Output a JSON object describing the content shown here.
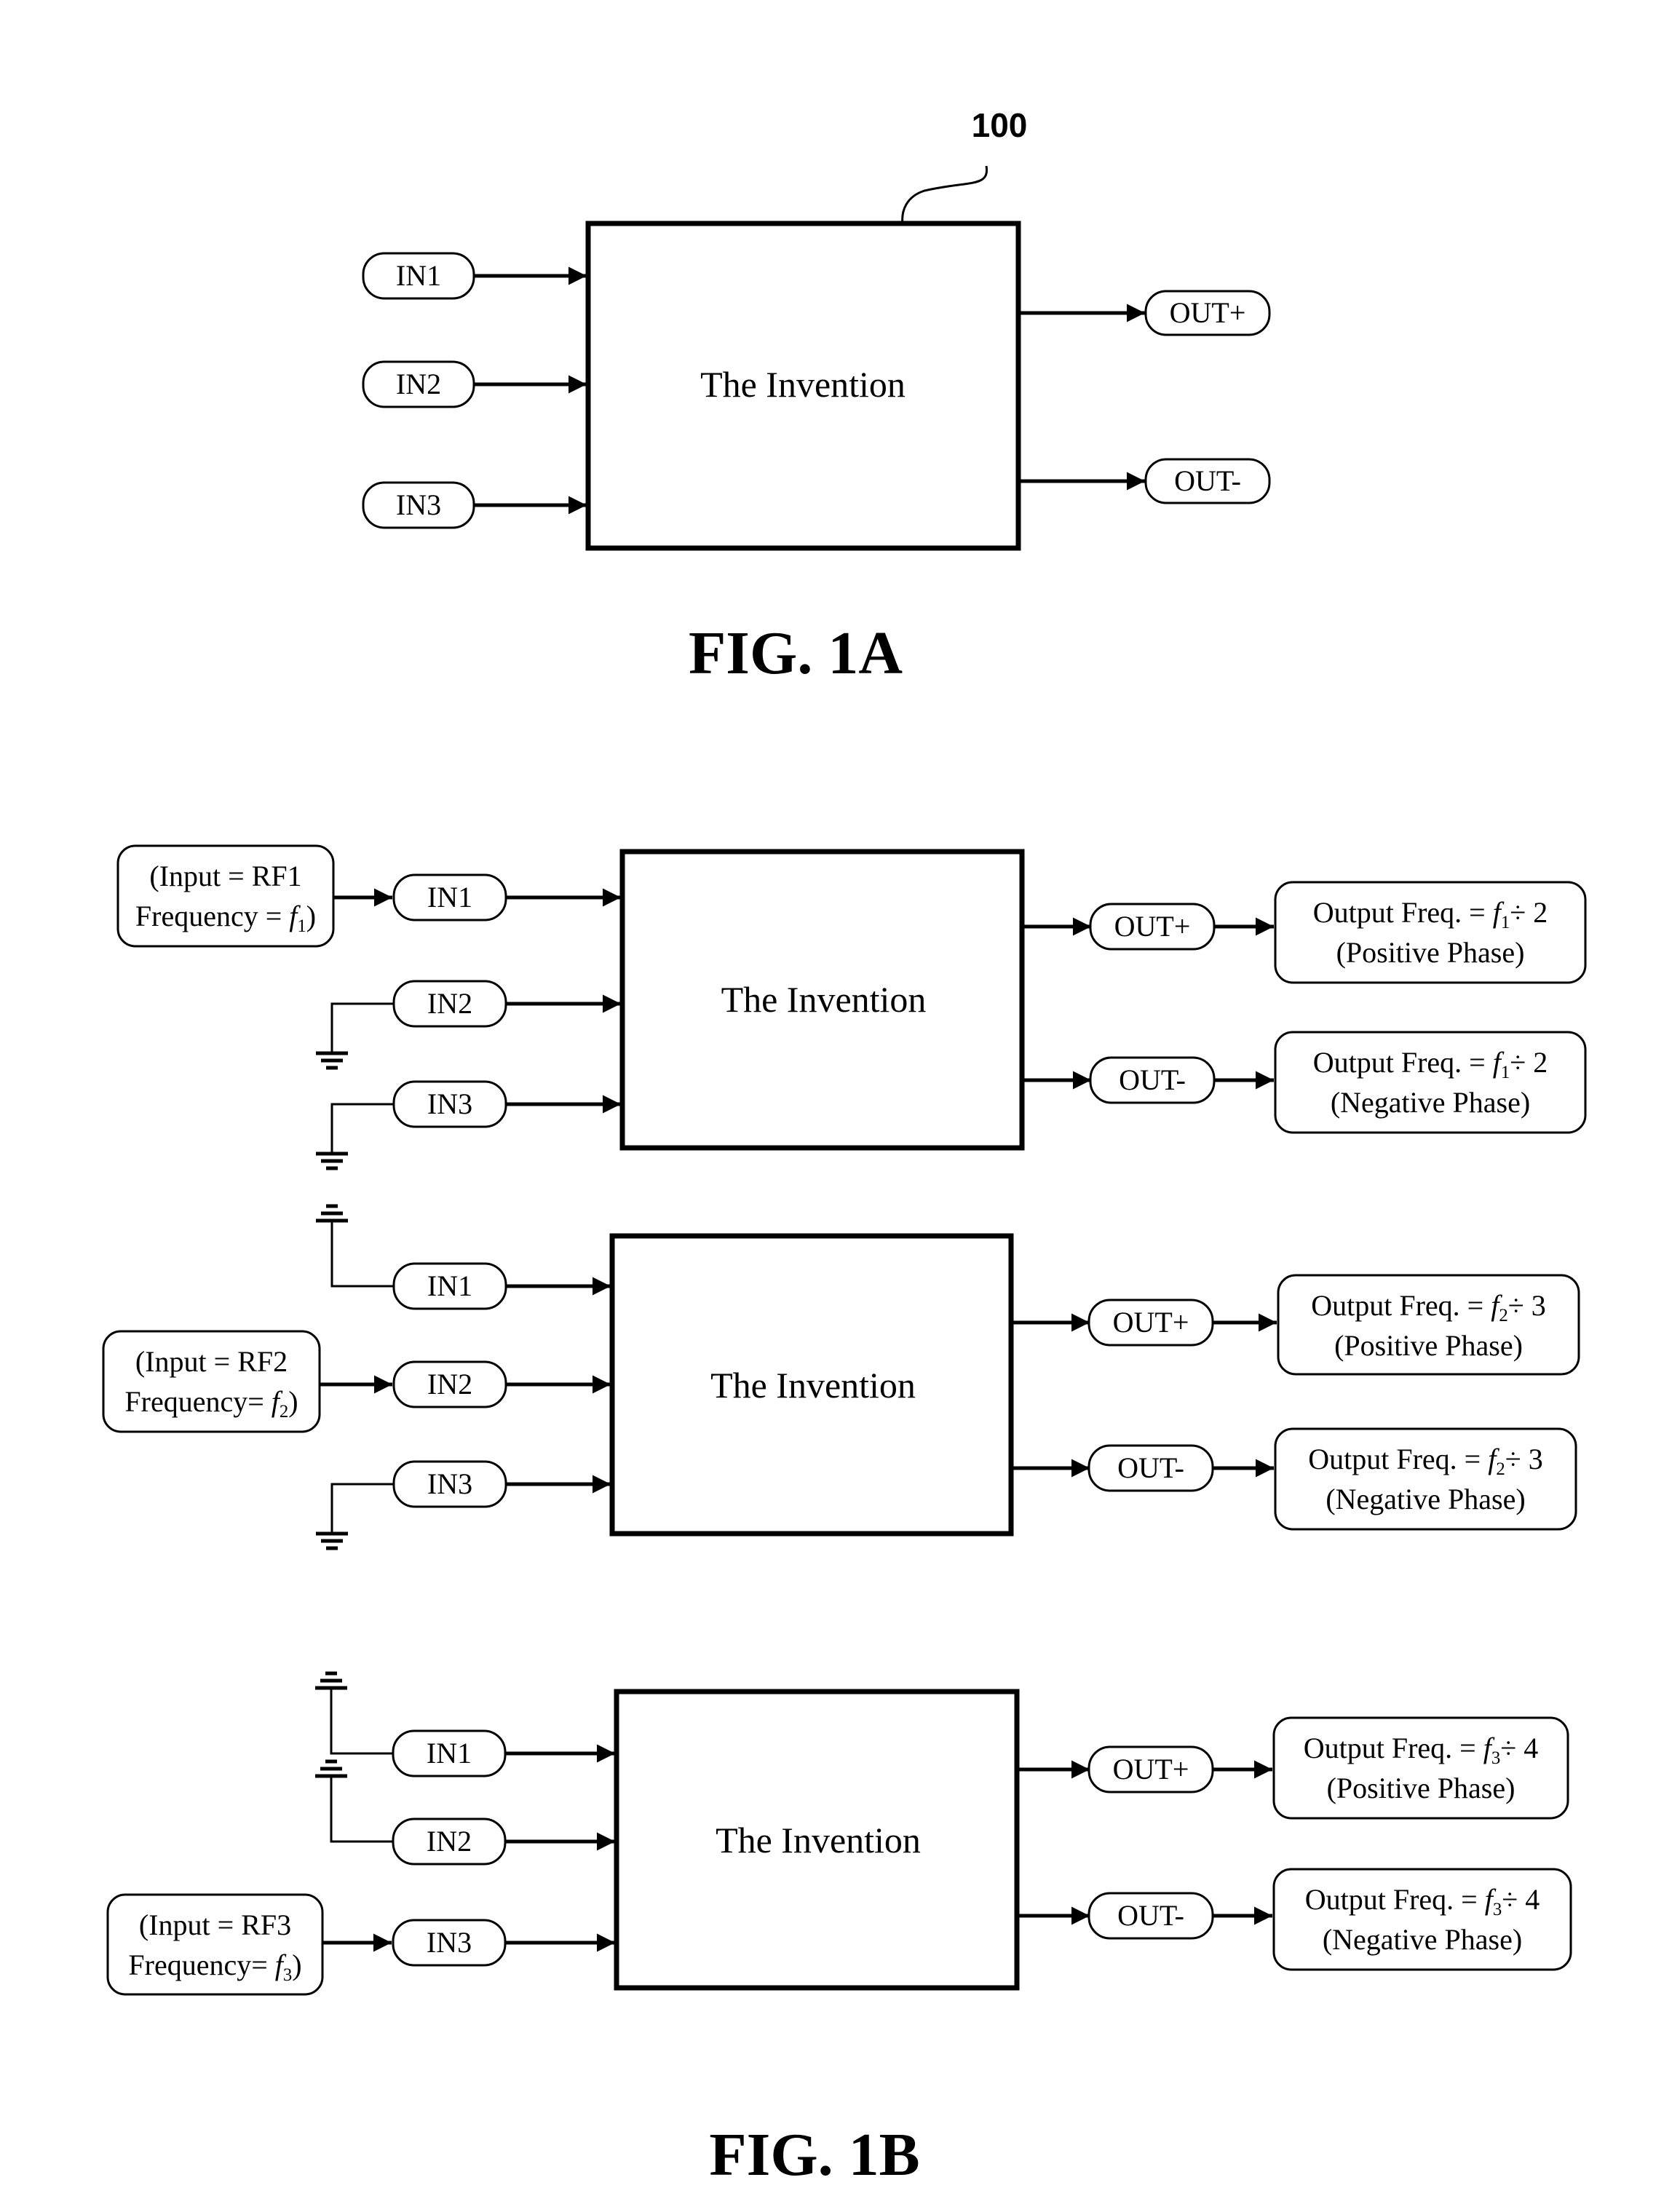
{
  "colors": {
    "ink": "#000000",
    "paper": "#ffffff"
  },
  "fig1a": {
    "ref_numeral": "100",
    "block_label": "The Invention",
    "inputs": [
      "IN1",
      "IN2",
      "IN3"
    ],
    "outputs": [
      "OUT+",
      "OUT-"
    ],
    "caption": "FIG. 1A"
  },
  "fig1b": {
    "caption": "FIG. 1B",
    "configs": [
      {
        "block_label": "The Invention",
        "inputs": [
          "IN1",
          "IN2",
          "IN3"
        ],
        "driven_input": "IN1",
        "grounded_inputs": [
          "IN2",
          "IN3"
        ],
        "source": {
          "line1": "(Input = RF1",
          "line2_prefix": "Frequency = ",
          "freq_symbol": "f",
          "freq_sub": "1",
          "line2_suffix": ")"
        },
        "outputs": [
          {
            "pin": "OUT+",
            "line1_prefix": "Output Freq. = ",
            "freq_symbol": "f",
            "freq_sub": "1",
            "divider": "÷ 2",
            "line2": "(Positive Phase)"
          },
          {
            "pin": "OUT-",
            "line1_prefix": "Output Freq. = ",
            "freq_symbol": "f",
            "freq_sub": "1",
            "divider": "÷ 2",
            "line2": "(Negative Phase)"
          }
        ]
      },
      {
        "block_label": "The Invention",
        "inputs": [
          "IN1",
          "IN2",
          "IN3"
        ],
        "driven_input": "IN2",
        "grounded_inputs": [
          "IN1",
          "IN3"
        ],
        "source": {
          "line1": "(Input = RF2",
          "line2_prefix": "Frequency= ",
          "freq_symbol": "f",
          "freq_sub": "2",
          "line2_suffix": ")"
        },
        "outputs": [
          {
            "pin": "OUT+",
            "line1_prefix": "Output Freq. = ",
            "freq_symbol": "f",
            "freq_sub": "2",
            "divider": "÷ 3",
            "line2": "(Positive Phase)"
          },
          {
            "pin": "OUT-",
            "line1_prefix": "Output Freq. = ",
            "freq_symbol": "f",
            "freq_sub": "2",
            "divider": "÷ 3",
            "line2": "(Negative Phase)"
          }
        ]
      },
      {
        "block_label": "The Invention",
        "inputs": [
          "IN1",
          "IN2",
          "IN3"
        ],
        "driven_input": "IN3",
        "grounded_inputs": [
          "IN1",
          "IN2"
        ],
        "source": {
          "line1": "(Input = RF3",
          "line2_prefix": "Frequency= ",
          "freq_symbol": "f",
          "freq_sub": "3",
          "line2_suffix": ")"
        },
        "outputs": [
          {
            "pin": "OUT+",
            "line1_prefix": "Output Freq. = ",
            "freq_symbol": "f",
            "freq_sub": "3",
            "divider": "÷ 4",
            "line2": "(Positive Phase)"
          },
          {
            "pin": "OUT-",
            "line1_prefix": "Output Freq. = ",
            "freq_symbol": "f",
            "freq_sub": "3",
            "divider": "÷ 4",
            "line2": "(Negative Phase)"
          }
        ]
      }
    ]
  }
}
